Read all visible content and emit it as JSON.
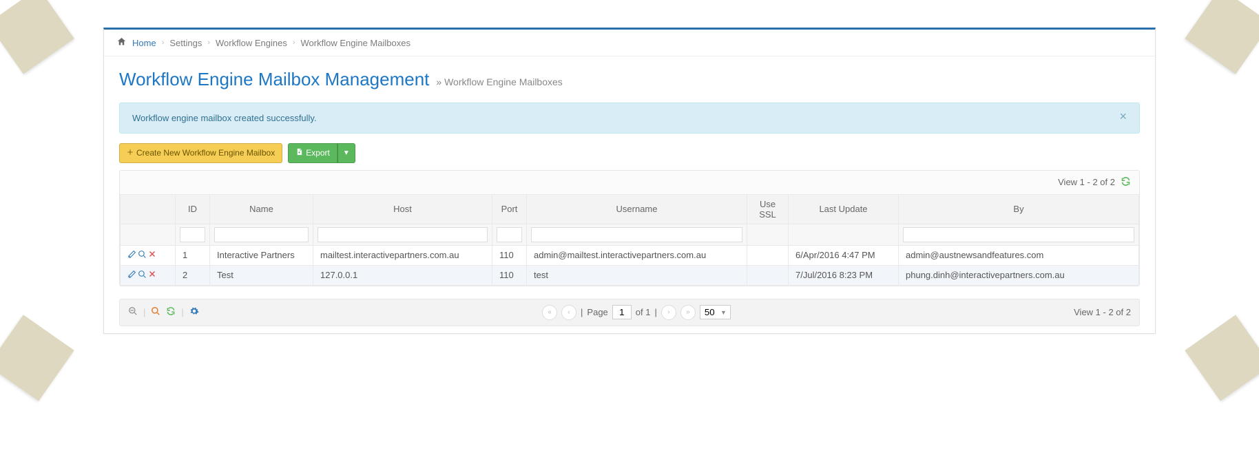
{
  "breadcrumb": {
    "home": "Home",
    "items": [
      "Settings",
      "Workflow Engines",
      "Workflow Engine Mailboxes"
    ]
  },
  "page": {
    "title": "Workflow Engine Mailbox Management",
    "subtitle": "» Workflow Engine Mailboxes"
  },
  "alert": {
    "message": "Workflow engine mailbox created successfully."
  },
  "toolbar": {
    "create_label": "Create New Workflow Engine Mailbox",
    "export_label": "Export"
  },
  "grid": {
    "view_summary_top": "View 1 - 2 of 2",
    "view_summary_bottom": "View 1 - 2 of 2",
    "columns": [
      "",
      "ID",
      "Name",
      "Host",
      "Port",
      "Username",
      "Use SSL",
      "Last Update",
      "By"
    ],
    "rows": [
      {
        "id": "1",
        "name": "Interactive Partners",
        "host": "mailtest.interactivepartners.com.au",
        "port": "110",
        "username": "admin@mailtest.interactivepartners.com.au",
        "use_ssl": "",
        "last_update": "6/Apr/2016 4:47 PM",
        "by": "admin@austnewsandfeatures.com"
      },
      {
        "id": "2",
        "name": "Test",
        "host": "127.0.0.1",
        "port": "110",
        "username": "test",
        "use_ssl": "",
        "last_update": "7/Jul/2016 8:23 PM",
        "by": "phung.dinh@interactivepartners.com.au"
      }
    ]
  },
  "pager": {
    "page_label": "Page",
    "page_value": "1",
    "of_label": "of 1",
    "page_size": "50"
  },
  "icons": {
    "home": "home-icon",
    "plus": "plus-icon",
    "file_export": "file-export-icon",
    "caret_down": "caret-down-icon",
    "refresh": "refresh-icon",
    "edit": "pencil-icon",
    "view": "magnifier-icon",
    "delete": "x-icon",
    "zoom_out": "zoom-out-icon",
    "search": "search-icon",
    "reload": "reload-icon",
    "gear": "gear-icon",
    "first": "first-page-icon",
    "prev": "prev-page-icon",
    "next": "next-page-icon",
    "last": "last-page-icon",
    "close": "close-icon"
  }
}
